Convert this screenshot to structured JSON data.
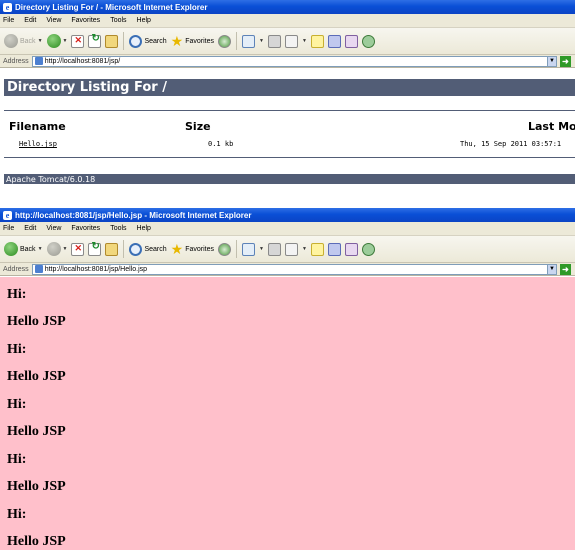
{
  "window1": {
    "title": "Directory Listing For / - Microsoft Internet Explorer",
    "menu": [
      "File",
      "Edit",
      "View",
      "Favorites",
      "Tools",
      "Help"
    ],
    "toolbar": {
      "back": "Back",
      "search": "Search",
      "favorites": "Favorites"
    },
    "address": {
      "label": "Address",
      "url": "http://localhost:8081/jsp/"
    },
    "page": {
      "heading": "Directory Listing For /",
      "columns": {
        "filename": "Filename",
        "size": "Size",
        "modified": "Last Mod"
      },
      "rows": [
        {
          "filename": "Hello.jsp",
          "size": "0.1 kb",
          "modified": "Thu, 15 Sep 2011 03:57:1"
        }
      ],
      "footer": "Apache Tomcat/6.0.18"
    }
  },
  "window2": {
    "title": "http://localhost:8081/jsp/Hello.jsp - Microsoft Internet Explorer",
    "menu": [
      "File",
      "Edit",
      "View",
      "Favorites",
      "Tools",
      "Help"
    ],
    "toolbar": {
      "back": "Back",
      "search": "Search",
      "favorites": "Favorites"
    },
    "address": {
      "label": "Address",
      "url": "http://localhost:8081/jsp/Hello.jsp"
    },
    "page": {
      "lines": [
        "Hi:",
        "Hello JSP",
        "Hi:",
        "Hello JSP",
        "Hi:",
        "Hello JSP",
        "Hi:",
        "Hello JSP",
        "Hi:",
        "Hello JSP"
      ],
      "background": "#ffc0cb"
    }
  },
  "colors": {
    "tomcat_bar": "#525d76",
    "titlebar": "#0a4fd6",
    "chrome": "#ece9d8"
  },
  "icons": [
    "ie-logo-icon",
    "back-icon",
    "forward-icon",
    "stop-icon",
    "refresh-icon",
    "home-icon",
    "search-icon",
    "favorites-icon",
    "history-icon",
    "mail-icon",
    "print-icon",
    "edit-icon",
    "discuss-icon",
    "messenger-icon",
    "research-icon",
    "bug-icon",
    "go-icon"
  ]
}
